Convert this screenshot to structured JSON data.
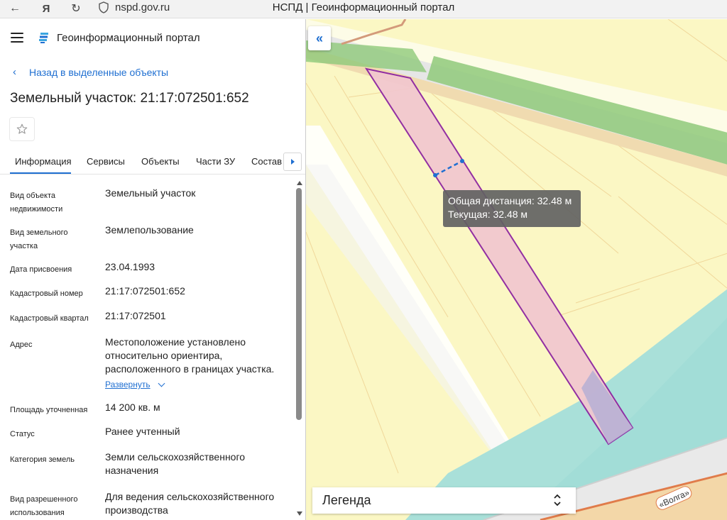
{
  "browser": {
    "url": "nspd.gov.ru",
    "title": "НСПД | Геоинформационный портал"
  },
  "header": {
    "portal_name": "Геоинформационный портал"
  },
  "back_link": "Назад в выделенные объекты",
  "object_title": "Земельный участок: 21:17:072501:652",
  "tabs": [
    {
      "label": "Информация",
      "active": true
    },
    {
      "label": "Сервисы"
    },
    {
      "label": "Объекты"
    },
    {
      "label": "Части ЗУ"
    },
    {
      "label": "Состав"
    }
  ],
  "info": [
    {
      "label": "Вид объекта недвижимости",
      "value": "Земельный участок"
    },
    {
      "label": "Вид земельного участка",
      "value": "Землепользование"
    },
    {
      "label": "Дата присвоения",
      "value": "23.04.1993"
    },
    {
      "label": "Кадастровый номер",
      "value": "21:17:072501:652"
    },
    {
      "label": "Кадастровый квартал",
      "value": "21:17:072501"
    },
    {
      "label": "Адрес",
      "value": "Местоположение установлено относительно ориентира, расположенного в границах участка.",
      "expand_label": "Развернуть"
    },
    {
      "label": "Площадь уточненная",
      "value": "14 200 кв. м"
    },
    {
      "label": "Статус",
      "value": "Ранее учтенный"
    },
    {
      "label": "Категория земель",
      "value": "Земли сельскохозяйственного назначения"
    },
    {
      "label": "Вид разрешенного использования",
      "value": "Для ведения сельскохозяйственного производства"
    }
  ],
  "map": {
    "tooltip_total": "Общая дистанция: 32.48 м",
    "tooltip_current": "Текущая: 32.48 м",
    "road_label": "«Волга»",
    "legend_label": "Легенда",
    "colors": {
      "parcel_fill": "#f2c7cf",
      "parcel_stroke": "#8a1fa0",
      "agri_land": "#fbf7c4",
      "water": "#a9e0d9",
      "green_strip": "#8fc97a",
      "accent": "#1f6fd1"
    }
  }
}
